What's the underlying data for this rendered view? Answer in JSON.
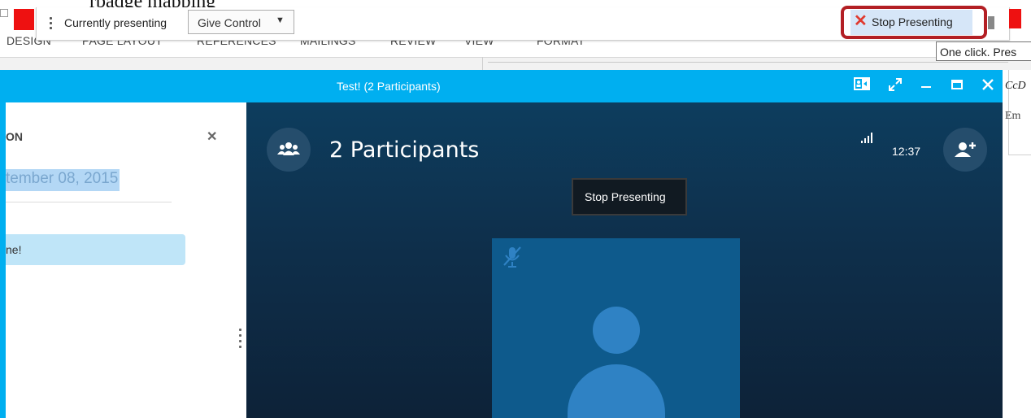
{
  "background": {
    "top_text": "rbadge mapping",
    "ribbon_tabs": [
      "DESIGN",
      "PAGE LAYOUT",
      "REFERENCES",
      "MAILINGS",
      "REVIEW",
      "VIEW",
      "FORMAT"
    ],
    "right_text_1": "CcD",
    "right_text_2": "Em",
    "tooltip": "One click. Pres"
  },
  "presenting_bar": {
    "status_label": "Currently presenting",
    "give_control_label": "Give Control",
    "stop_presenting_label": "Stop Presenting"
  },
  "skype": {
    "title": "Test! (2 Participants)",
    "left_panel": {
      "title": "ON",
      "date_text": "tember 08, 2015",
      "message": "ne!"
    },
    "call": {
      "participants_label": "2 Participants",
      "time": "12:37",
      "tooltip": "Stop Presenting"
    }
  },
  "colors": {
    "skype_blue": "#00aff0",
    "call_dark": "#0d2c47",
    "highlight_red": "#b31f24",
    "stop_x_red": "#e03a2f"
  },
  "icons": [
    "close-x-icon",
    "dropdown-caret-icon",
    "participants-icon",
    "add-participant-icon",
    "signal-icon",
    "mic-muted-icon",
    "avatar-icon",
    "dock-icon",
    "expand-icon",
    "minimize-icon",
    "maximize-icon",
    "close-icon"
  ]
}
